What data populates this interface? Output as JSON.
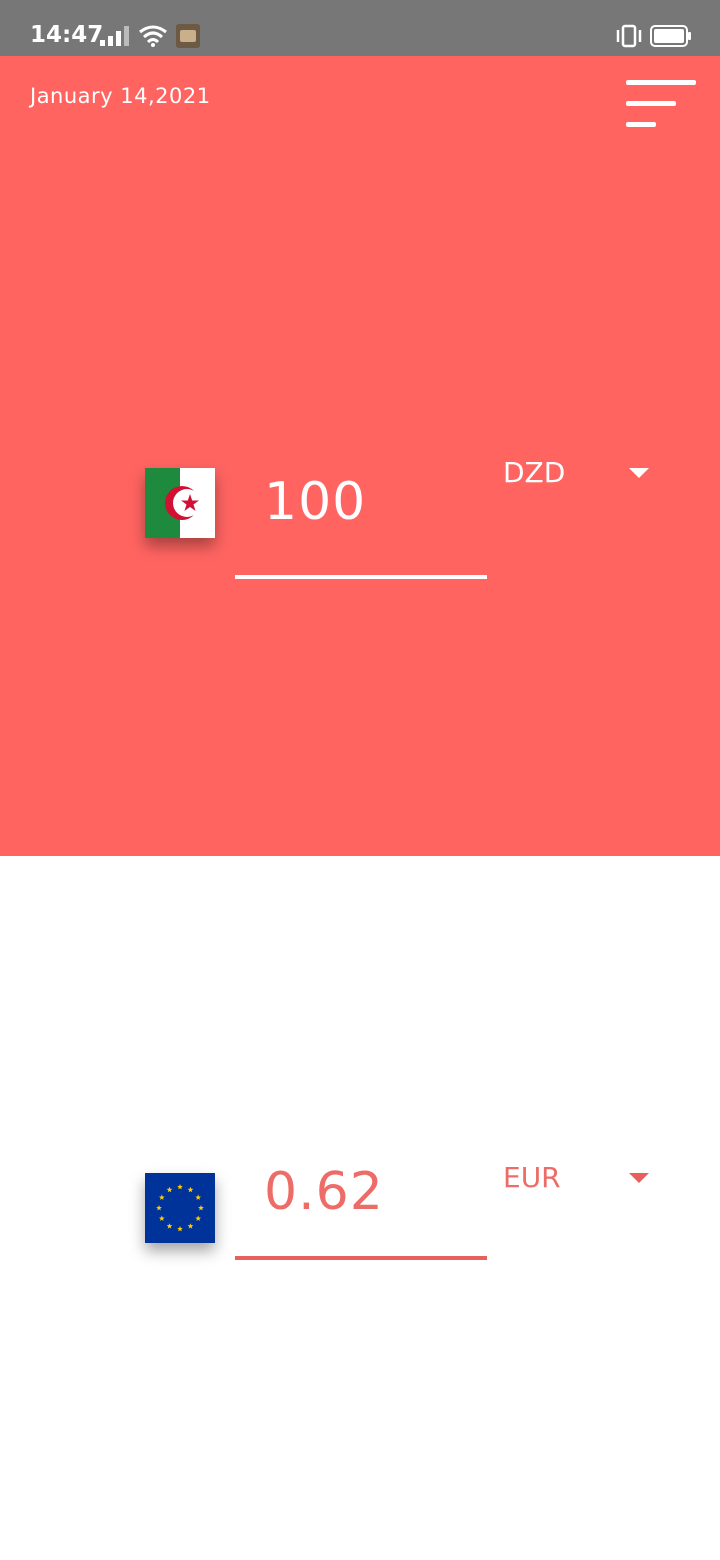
{
  "status_bar": {
    "time": "14:47"
  },
  "header": {
    "date": "January 14,2021"
  },
  "from": {
    "amount": "100",
    "currency": "DZD",
    "flag": "algeria-flag-icon"
  },
  "to": {
    "amount": "0.62",
    "currency": "EUR",
    "flag": "eu-flag-icon"
  },
  "colors": {
    "accent": "#ff6461",
    "status_bar": "#777777",
    "background": "#ffffff"
  }
}
